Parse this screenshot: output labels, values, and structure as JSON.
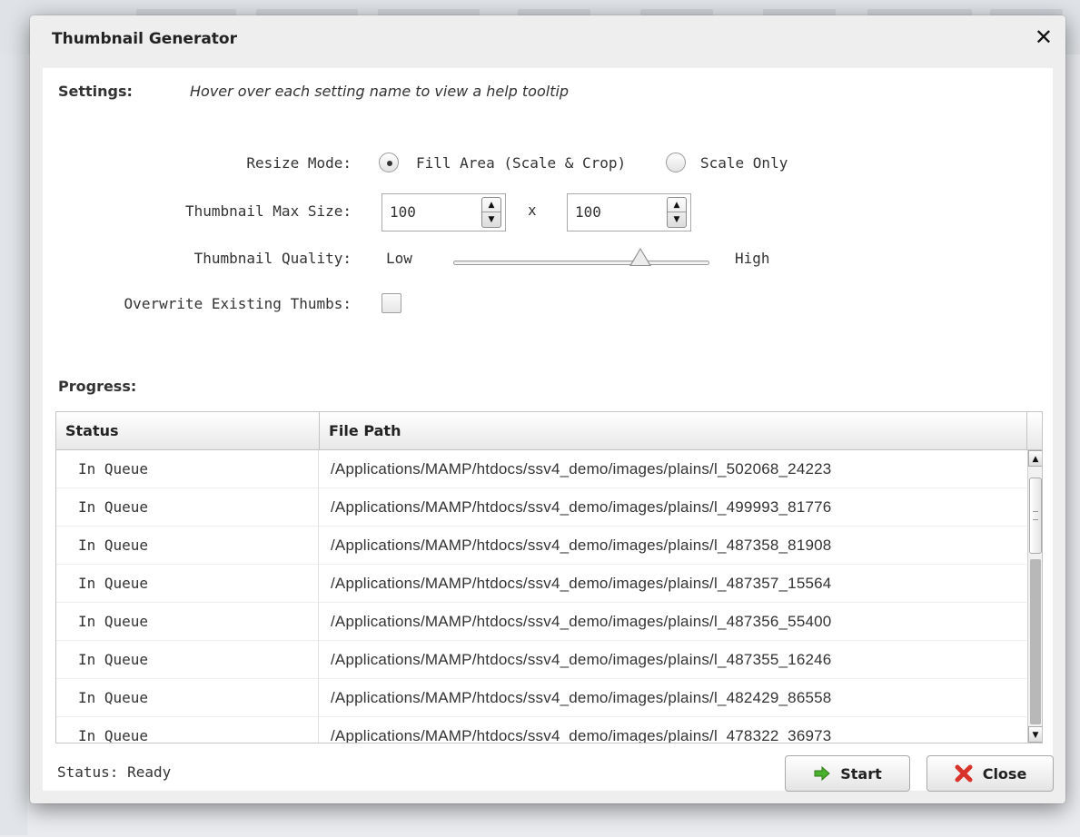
{
  "dialog": {
    "title": "Thumbnail Generator",
    "close_glyph": "✕",
    "close_icon": "close-icon"
  },
  "settings": {
    "label": "Settings:",
    "hint": "Hover over each setting name to view a help tooltip",
    "resize_mode": {
      "label": "Resize Mode:",
      "options": [
        {
          "label": "Fill Area (Scale & Crop)",
          "selected": true
        },
        {
          "label": "Scale Only",
          "selected": false
        }
      ]
    },
    "max_size": {
      "label": "Thumbnail Max Size:",
      "width": "100",
      "separator": "x",
      "height": "100"
    },
    "quality": {
      "label": "Thumbnail Quality:",
      "low_label": "Low",
      "high_label": "High",
      "value_fraction": 0.73
    },
    "overwrite": {
      "label": "Overwrite Existing Thumbs:",
      "checked": false
    }
  },
  "progress": {
    "label": "Progress:",
    "columns": [
      "Status",
      "File Path"
    ],
    "rows": [
      {
        "status": "In Queue",
        "path": "/Applications/MAMP/htdocs/ssv4_demo/images/plains/l_502068_24223"
      },
      {
        "status": "In Queue",
        "path": "/Applications/MAMP/htdocs/ssv4_demo/images/plains/l_499993_81776"
      },
      {
        "status": "In Queue",
        "path": "/Applications/MAMP/htdocs/ssv4_demo/images/plains/l_487358_81908"
      },
      {
        "status": "In Queue",
        "path": "/Applications/MAMP/htdocs/ssv4_demo/images/plains/l_487357_15564"
      },
      {
        "status": "In Queue",
        "path": "/Applications/MAMP/htdocs/ssv4_demo/images/plains/l_487356_55400"
      },
      {
        "status": "In Queue",
        "path": "/Applications/MAMP/htdocs/ssv4_demo/images/plains/l_487355_16246"
      },
      {
        "status": "In Queue",
        "path": "/Applications/MAMP/htdocs/ssv4_demo/images/plains/l_482429_86558"
      },
      {
        "status": "In Queue",
        "path": "/Applications/MAMP/htdocs/ssv4_demo/images/plains/l_478322_36973"
      }
    ]
  },
  "footer": {
    "status": "Status: Ready",
    "start_label": "Start",
    "close_label": "Close",
    "start_icon": "arrow-right-icon",
    "close_icon": "red-x-icon",
    "start_icon_color": "#49b02d",
    "close_icon_color": "#d9342b"
  }
}
